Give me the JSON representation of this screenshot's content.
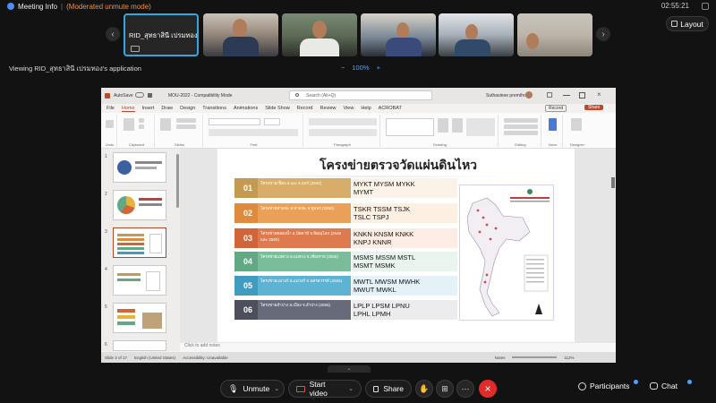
{
  "top": {
    "meeting_info": "Meeting Info",
    "moderated_status": "(Moderated unmute mode)",
    "clock": "02:55:21",
    "layout_label": "Layout"
  },
  "participants_strip": {
    "self_name": "RID_สุทธาสินี เปรมทอง"
  },
  "viewing": {
    "text": "Viewing RID_สุทธาสินี เปรมทอง's application",
    "zoom": "100%",
    "minus": "−",
    "plus": "+"
  },
  "ppt": {
    "autosave": "AutoSave",
    "filename": "MOU-2022 - Compatibility Mode",
    "search_placeholder": "Search (Alt+Q)",
    "user": "Suthasinee premthong",
    "tabs": [
      "File",
      "Home",
      "Insert",
      "Draw",
      "Design",
      "Transitions",
      "Animations",
      "Slide Show",
      "Record",
      "Review",
      "View",
      "Help",
      "ACROBAT"
    ],
    "record_label": "Record",
    "share_label": "Share",
    "groups": [
      "Undo",
      "Clipboard",
      "Slides",
      "Font",
      "Paragraph",
      "Drawing",
      "Editing",
      "Voice",
      "Designer"
    ],
    "notes_placeholder": "Click to add notes",
    "status": {
      "slide": "Slide 3 of 17",
      "language": "English (United States)",
      "accessibility": "Accessibility: Unavailable",
      "notes": "Notes",
      "zoom": "112%"
    }
  },
  "slide": {
    "title": "โครงข่ายตรวจวัดแผ่นดินไหว",
    "rows": [
      {
        "num": "01",
        "desc": "โครงข่ายเขื่อน อ.xxx จ.แพร่ (2542)",
        "codes": [
          "MYKT MYSM MYKK",
          "MYMT"
        ],
        "num_color": "#c49a53",
        "desc_color": "#d8ad6a"
      },
      {
        "num": "02",
        "desc": "โครงข่ายท่าแซะ อ.ท่าแซะ จ.ชุมพร (2550)",
        "codes": [
          "TSKR TSSM TSJK",
          "TSLC TSPJ"
        ],
        "num_color": "#e08a3e",
        "desc_color": "#eba058"
      },
      {
        "num": "03",
        "desc": "โครงข่ายคลองน้ำ อ.ปัตตานี จ.พิษณุโลก (2549 และ 2560)",
        "codes": [
          "KNKN KNSM KNKK",
          "KNPJ KNNR"
        ],
        "num_color": "#d0653a",
        "desc_color": "#de7b4e"
      },
      {
        "num": "04",
        "desc": "โครงข่ายแม่ตวง อ.แม่ตวง จ.เชียงราย (2555)",
        "codes": [
          "MSMS MSSM MSTL",
          "MSMT MSMK"
        ],
        "num_color": "#62a884",
        "desc_color": "#7abd9a"
      },
      {
        "num": "05",
        "desc": "โครงข่ายแม่วงก์ อ.แม่วงก์ จ.นครสวรรค์ (2555)",
        "codes": [
          "MWTL MWSM MWHK",
          "MWUT MWKL"
        ],
        "num_color": "#3f9cc0",
        "desc_color": "#5cb3d3"
      },
      {
        "num": "06",
        "desc": "โครงข่ายลำปาง อ.เมือง จ.ลำปาง (2556)",
        "codes": [
          "LPLP LPSM LPNU",
          "LPHL LPMH"
        ],
        "num_color": "#4d4f5c",
        "desc_color": "#676a78"
      }
    ]
  },
  "controls": {
    "unmute": "Unmute",
    "start_video": "Start video",
    "share": "Share",
    "participants": "Participants",
    "chat": "Chat"
  },
  "colors": {
    "accent": "#35a7e0",
    "warning": "#f0913a",
    "end_call": "#e02b2b",
    "ppt_accent": "#b7472a"
  }
}
